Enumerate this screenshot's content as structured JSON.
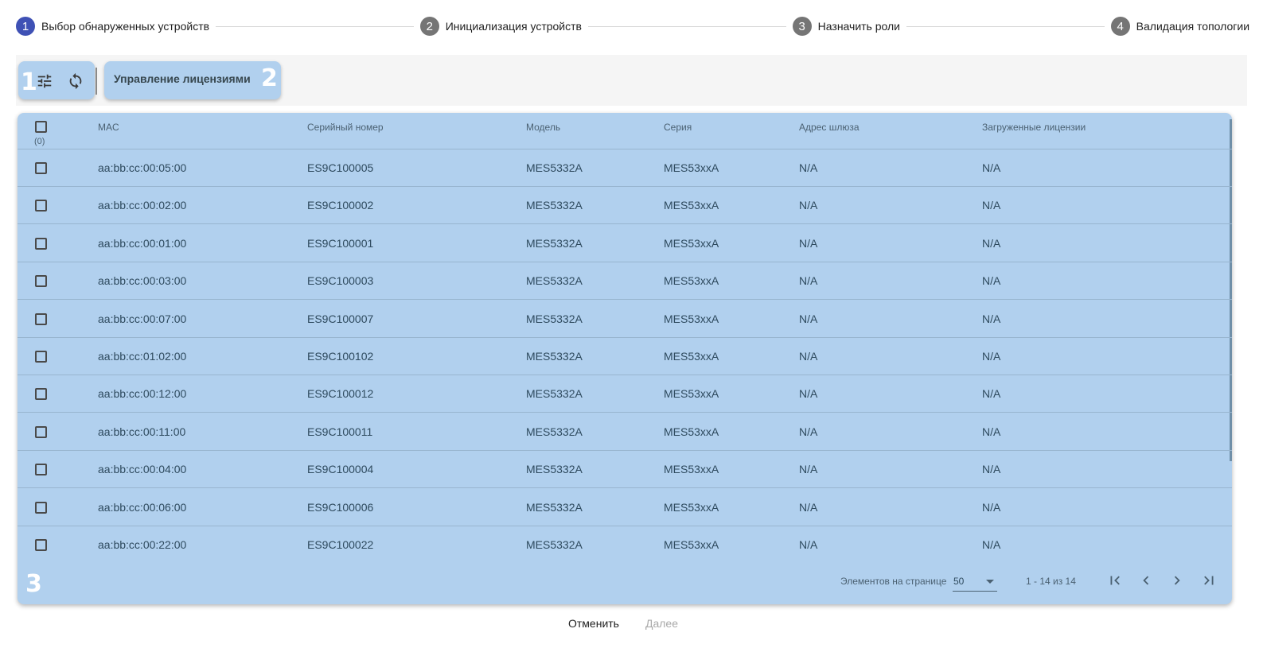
{
  "stepper": {
    "steps": [
      {
        "num": "1",
        "label": "Выбор обнаруженных устройств"
      },
      {
        "num": "2",
        "label": "Инициализация устройств"
      },
      {
        "num": "3",
        "label": "Назначить роли"
      },
      {
        "num": "4",
        "label": "Валидация топологии"
      }
    ]
  },
  "toolbar": {
    "filter_icon": "tune-icon",
    "refresh_icon": "refresh-icon",
    "license_button": "Управление лицензиями",
    "badge1": "1",
    "badge2": "2"
  },
  "table": {
    "badge3": "3",
    "selected_count": "(0)",
    "columns": [
      "MAC",
      "Серийный номер",
      "Модель",
      "Серия",
      "Адрес шлюза",
      "Загруженные лицензии"
    ],
    "rows": [
      [
        "aa:bb:cc:00:05:00",
        "ES9C100005",
        "MES5332A",
        "MES53xxA",
        "N/A",
        "N/A"
      ],
      [
        "aa:bb:cc:00:02:00",
        "ES9C100002",
        "MES5332A",
        "MES53xxA",
        "N/A",
        "N/A"
      ],
      [
        "aa:bb:cc:00:01:00",
        "ES9C100001",
        "MES5332A",
        "MES53xxA",
        "N/A",
        "N/A"
      ],
      [
        "aa:bb:cc:00:03:00",
        "ES9C100003",
        "MES5332A",
        "MES53xxA",
        "N/A",
        "N/A"
      ],
      [
        "aa:bb:cc:00:07:00",
        "ES9C100007",
        "MES5332A",
        "MES53xxA",
        "N/A",
        "N/A"
      ],
      [
        "aa:bb:cc:01:02:00",
        "ES9C100102",
        "MES5332A",
        "MES53xxA",
        "N/A",
        "N/A"
      ],
      [
        "aa:bb:cc:00:12:00",
        "ES9C100012",
        "MES5332A",
        "MES53xxA",
        "N/A",
        "N/A"
      ],
      [
        "aa:bb:cc:00:11:00",
        "ES9C100011",
        "MES5332A",
        "MES53xxA",
        "N/A",
        "N/A"
      ],
      [
        "aa:bb:cc:00:04:00",
        "ES9C100004",
        "MES5332A",
        "MES53xxA",
        "N/A",
        "N/A"
      ],
      [
        "aa:bb:cc:00:06:00",
        "ES9C100006",
        "MES5332A",
        "MES53xxA",
        "N/A",
        "N/A"
      ],
      [
        "aa:bb:cc:00:22:00",
        "ES9C100022",
        "MES5332A",
        "MES53xxA",
        "N/A",
        "N/A"
      ]
    ]
  },
  "paginator": {
    "items_per_page_label": "Элементов на странице",
    "page_size": "50",
    "range": "1 - 14 из 14"
  },
  "footer": {
    "cancel": "Отменить",
    "next": "Далее"
  },
  "colors": {
    "active_step": "#3f51b5",
    "inactive_step": "#757575",
    "highlight": "#b1d0ee"
  }
}
